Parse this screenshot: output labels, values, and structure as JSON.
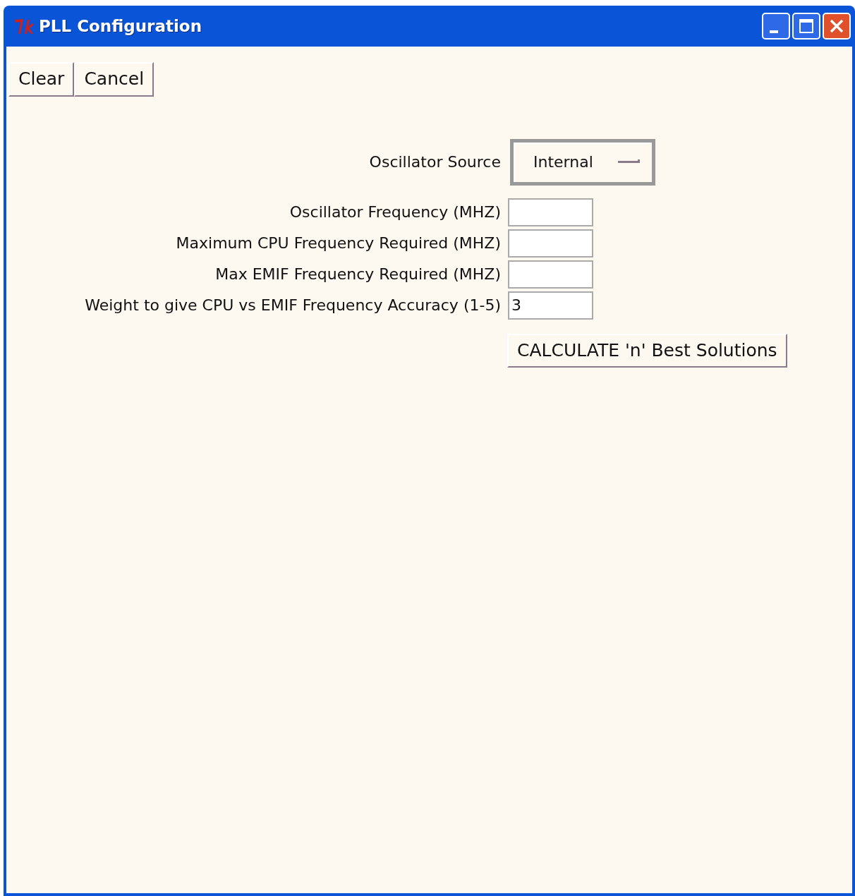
{
  "window": {
    "title": "PLL Configuration"
  },
  "toolbar": [
    "Clear",
    "Cancel"
  ],
  "form": [
    {
      "kind": "select",
      "label": "Oscillator Source",
      "value": "Internal"
    },
    {
      "kind": "entry",
      "label": "Oscillator Frequency (MHZ)"
    },
    {
      "kind": "entry",
      "label": "Maximum CPU Frequency Required (MHZ)"
    },
    {
      "kind": "entry",
      "label": "Max EMIF Frequency Required (MHZ)"
    },
    {
      "kind": "entry",
      "label": "Weight to give CPU vs EMIF Frequency Accuracy (1-5)",
      "value": "3"
    }
  ],
  "calculate_button": "CALCULATE 'n' Best Solutions"
}
